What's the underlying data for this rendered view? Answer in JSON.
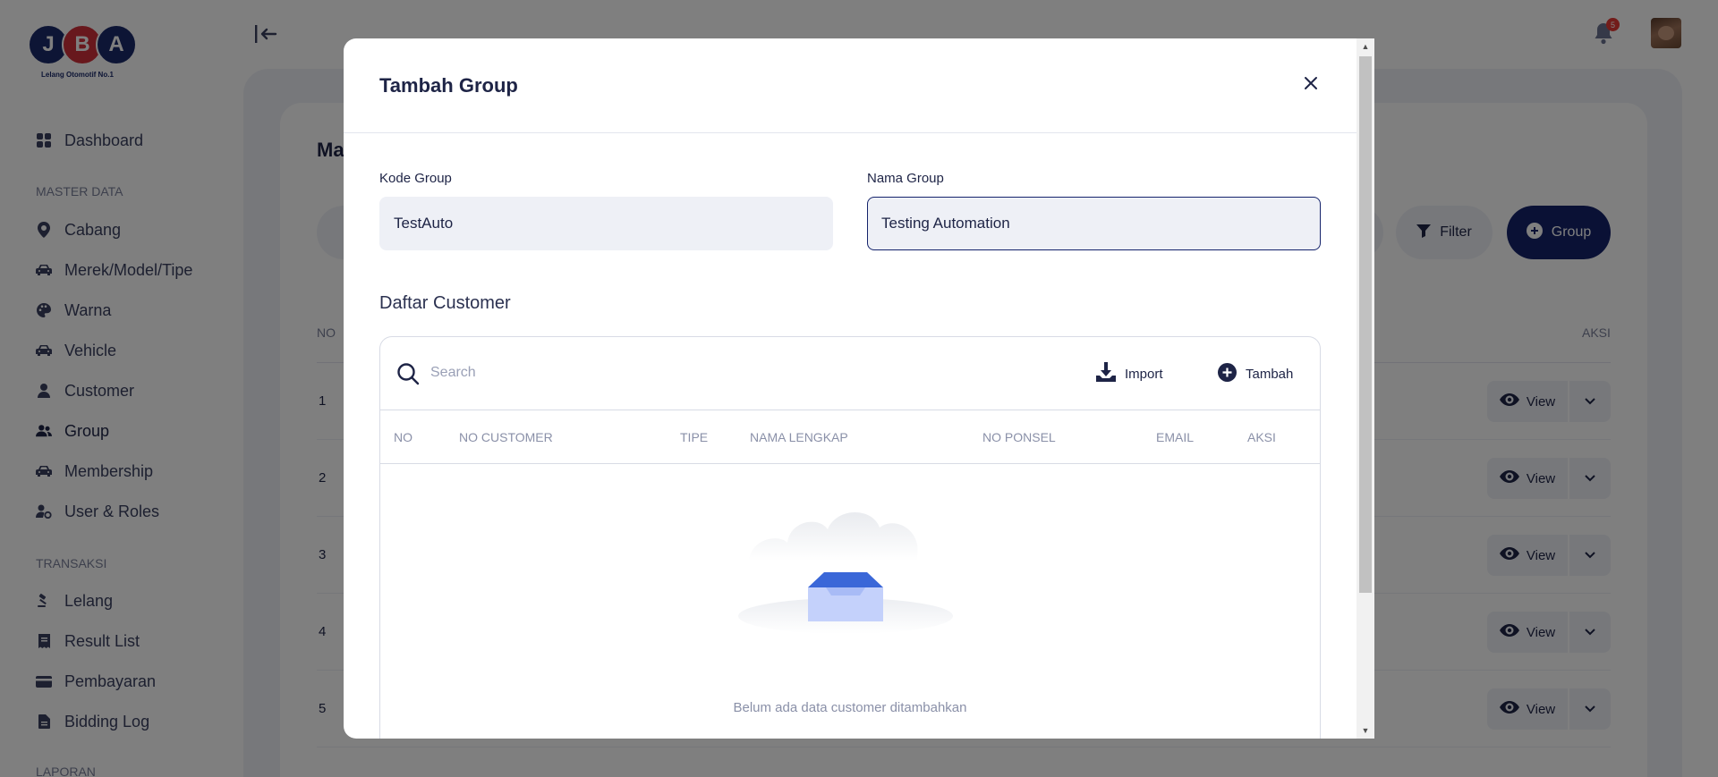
{
  "brand": {
    "letters": [
      "J",
      "B",
      "A"
    ],
    "tagline": "Lelang Otomotif No.1",
    "colors": {
      "primary": "#1b2a6b",
      "accent": "#d0303a"
    }
  },
  "sidebar": {
    "dashboard": {
      "label": "Dashboard",
      "icon": "dashboard-icon"
    },
    "sections": [
      {
        "title": "MASTER DATA",
        "items": [
          {
            "label": "Cabang",
            "icon": "location-pin-icon"
          },
          {
            "label": "Merek/Model/Tipe",
            "icon": "car-icon"
          },
          {
            "label": "Warna",
            "icon": "palette-icon"
          },
          {
            "label": "Vehicle",
            "icon": "car-icon"
          },
          {
            "label": "Customer",
            "icon": "user-icon"
          },
          {
            "label": "Group",
            "icon": "users-icon",
            "active": true
          },
          {
            "label": "Membership",
            "icon": "car-icon"
          },
          {
            "label": "User & Roles",
            "icon": "user-gear-icon"
          }
        ]
      },
      {
        "title": "TRANSAKSI",
        "items": [
          {
            "label": "Lelang",
            "icon": "gavel-icon"
          },
          {
            "label": "Result List",
            "icon": "receipt-icon"
          },
          {
            "label": "Pembayaran",
            "icon": "credit-card-icon"
          },
          {
            "label": "Bidding Log",
            "icon": "file-icon"
          }
        ]
      },
      {
        "title": "LAPORAN",
        "items": []
      }
    ]
  },
  "topbar": {
    "notification_count": "5"
  },
  "page": {
    "title": "Ma",
    "filter_label": "Filter",
    "group_button_label": "Group",
    "table": {
      "col_no": "NO",
      "col_aksi": "AKSI",
      "rows": [
        {
          "no": "1",
          "view_label": "View"
        },
        {
          "no": "2",
          "view_label": "View"
        },
        {
          "no": "3",
          "view_label": "View"
        },
        {
          "no": "4",
          "view_label": "View"
        },
        {
          "no": "5",
          "view_label": "View"
        }
      ]
    }
  },
  "modal": {
    "title": "Tambah Group",
    "kode_group": {
      "label": "Kode Group",
      "value": "TestAuto"
    },
    "nama_group": {
      "label": "Nama Group",
      "value": "Testing Automation"
    },
    "customer_section": {
      "title": "Daftar Customer",
      "search_placeholder": "Search",
      "import_label": "Import",
      "tambah_label": "Tambah",
      "columns": [
        "NO",
        "NO CUSTOMER",
        "TIPE",
        "NAMA LENGKAP",
        "NO PONSEL",
        "EMAIL",
        "AKSI"
      ],
      "empty_text": "Belum ada data customer ditambahkan"
    }
  }
}
